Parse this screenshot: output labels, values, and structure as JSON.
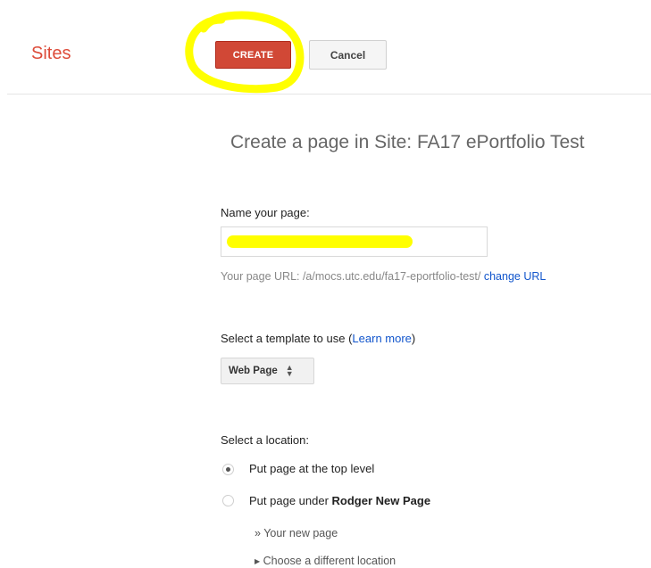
{
  "header": {
    "app_title": "Sites",
    "create_label": "CREATE",
    "cancel_label": "Cancel"
  },
  "main": {
    "page_heading": "Create a page in Site: FA17 ePortfolio Test",
    "name_label": "Name your page:",
    "name_value": "",
    "url_prefix": "Your page URL: /a/mocs.utc.edu/fa17-eportfolio-test/",
    "change_url_label": "change URL",
    "template_label": "Select a template to use (",
    "learn_more_label": "Learn more",
    "template_label_close": ")",
    "template_selected": "Web Page",
    "location_label": "Select a location:",
    "option_top_level": "Put page at the top level",
    "option_under_prefix": "Put page under ",
    "option_under_page": "Rodger New Page",
    "new_page_path": "» Your new page",
    "choose_location": "Choose a different location"
  },
  "colors": {
    "accent": "#dd4b39",
    "create_button": "#d14836",
    "link": "#1155cc",
    "highlight": "#ffff00"
  }
}
